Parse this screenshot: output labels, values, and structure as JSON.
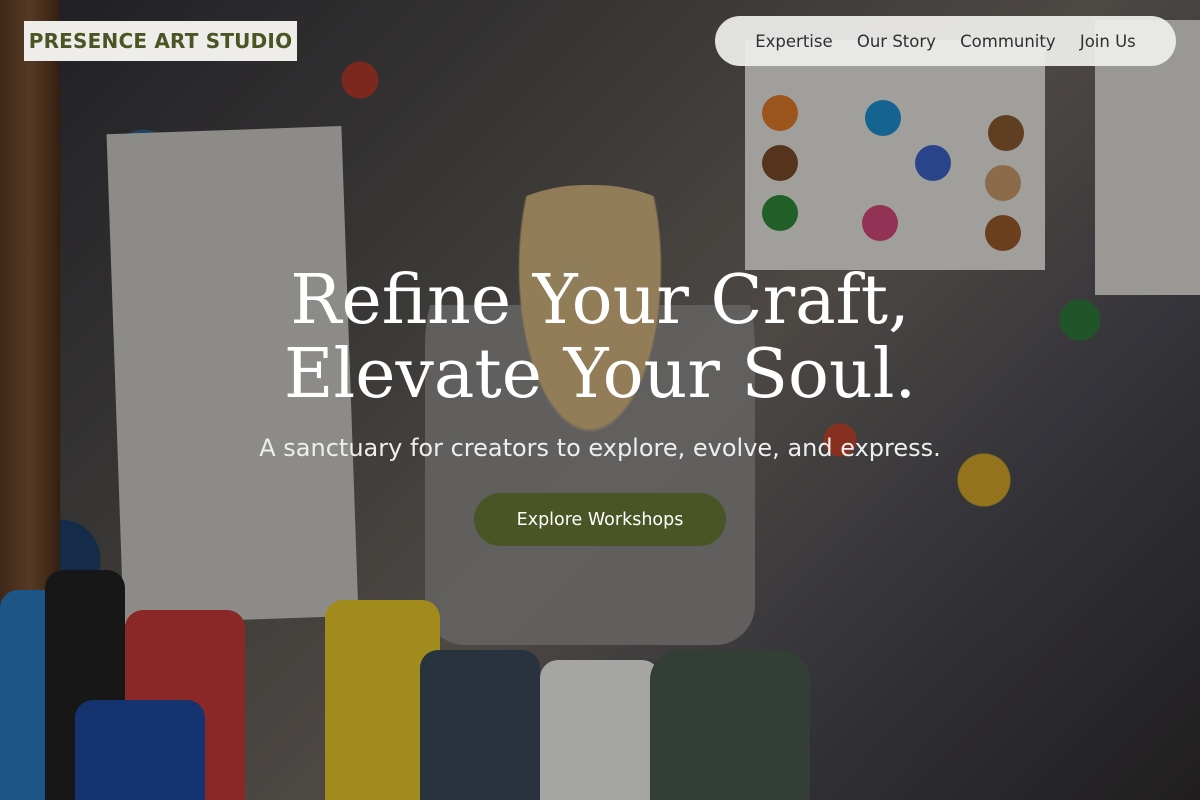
{
  "brand": {
    "name": "PRESENCE ART STUDIO",
    "color": "#4a5526"
  },
  "nav": {
    "items": [
      {
        "label": "Expertise"
      },
      {
        "label": "Our Story"
      },
      {
        "label": "Community"
      },
      {
        "label": "Join Us"
      }
    ]
  },
  "hero": {
    "title_line1": "Refine Your Craft,",
    "title_line2": "Elevate Your Soul.",
    "subtitle": "A sanctuary for creators to explore, evolve, and express.",
    "cta_label": "Explore Workshops"
  },
  "background": {
    "icon": "art-studio-photo"
  }
}
